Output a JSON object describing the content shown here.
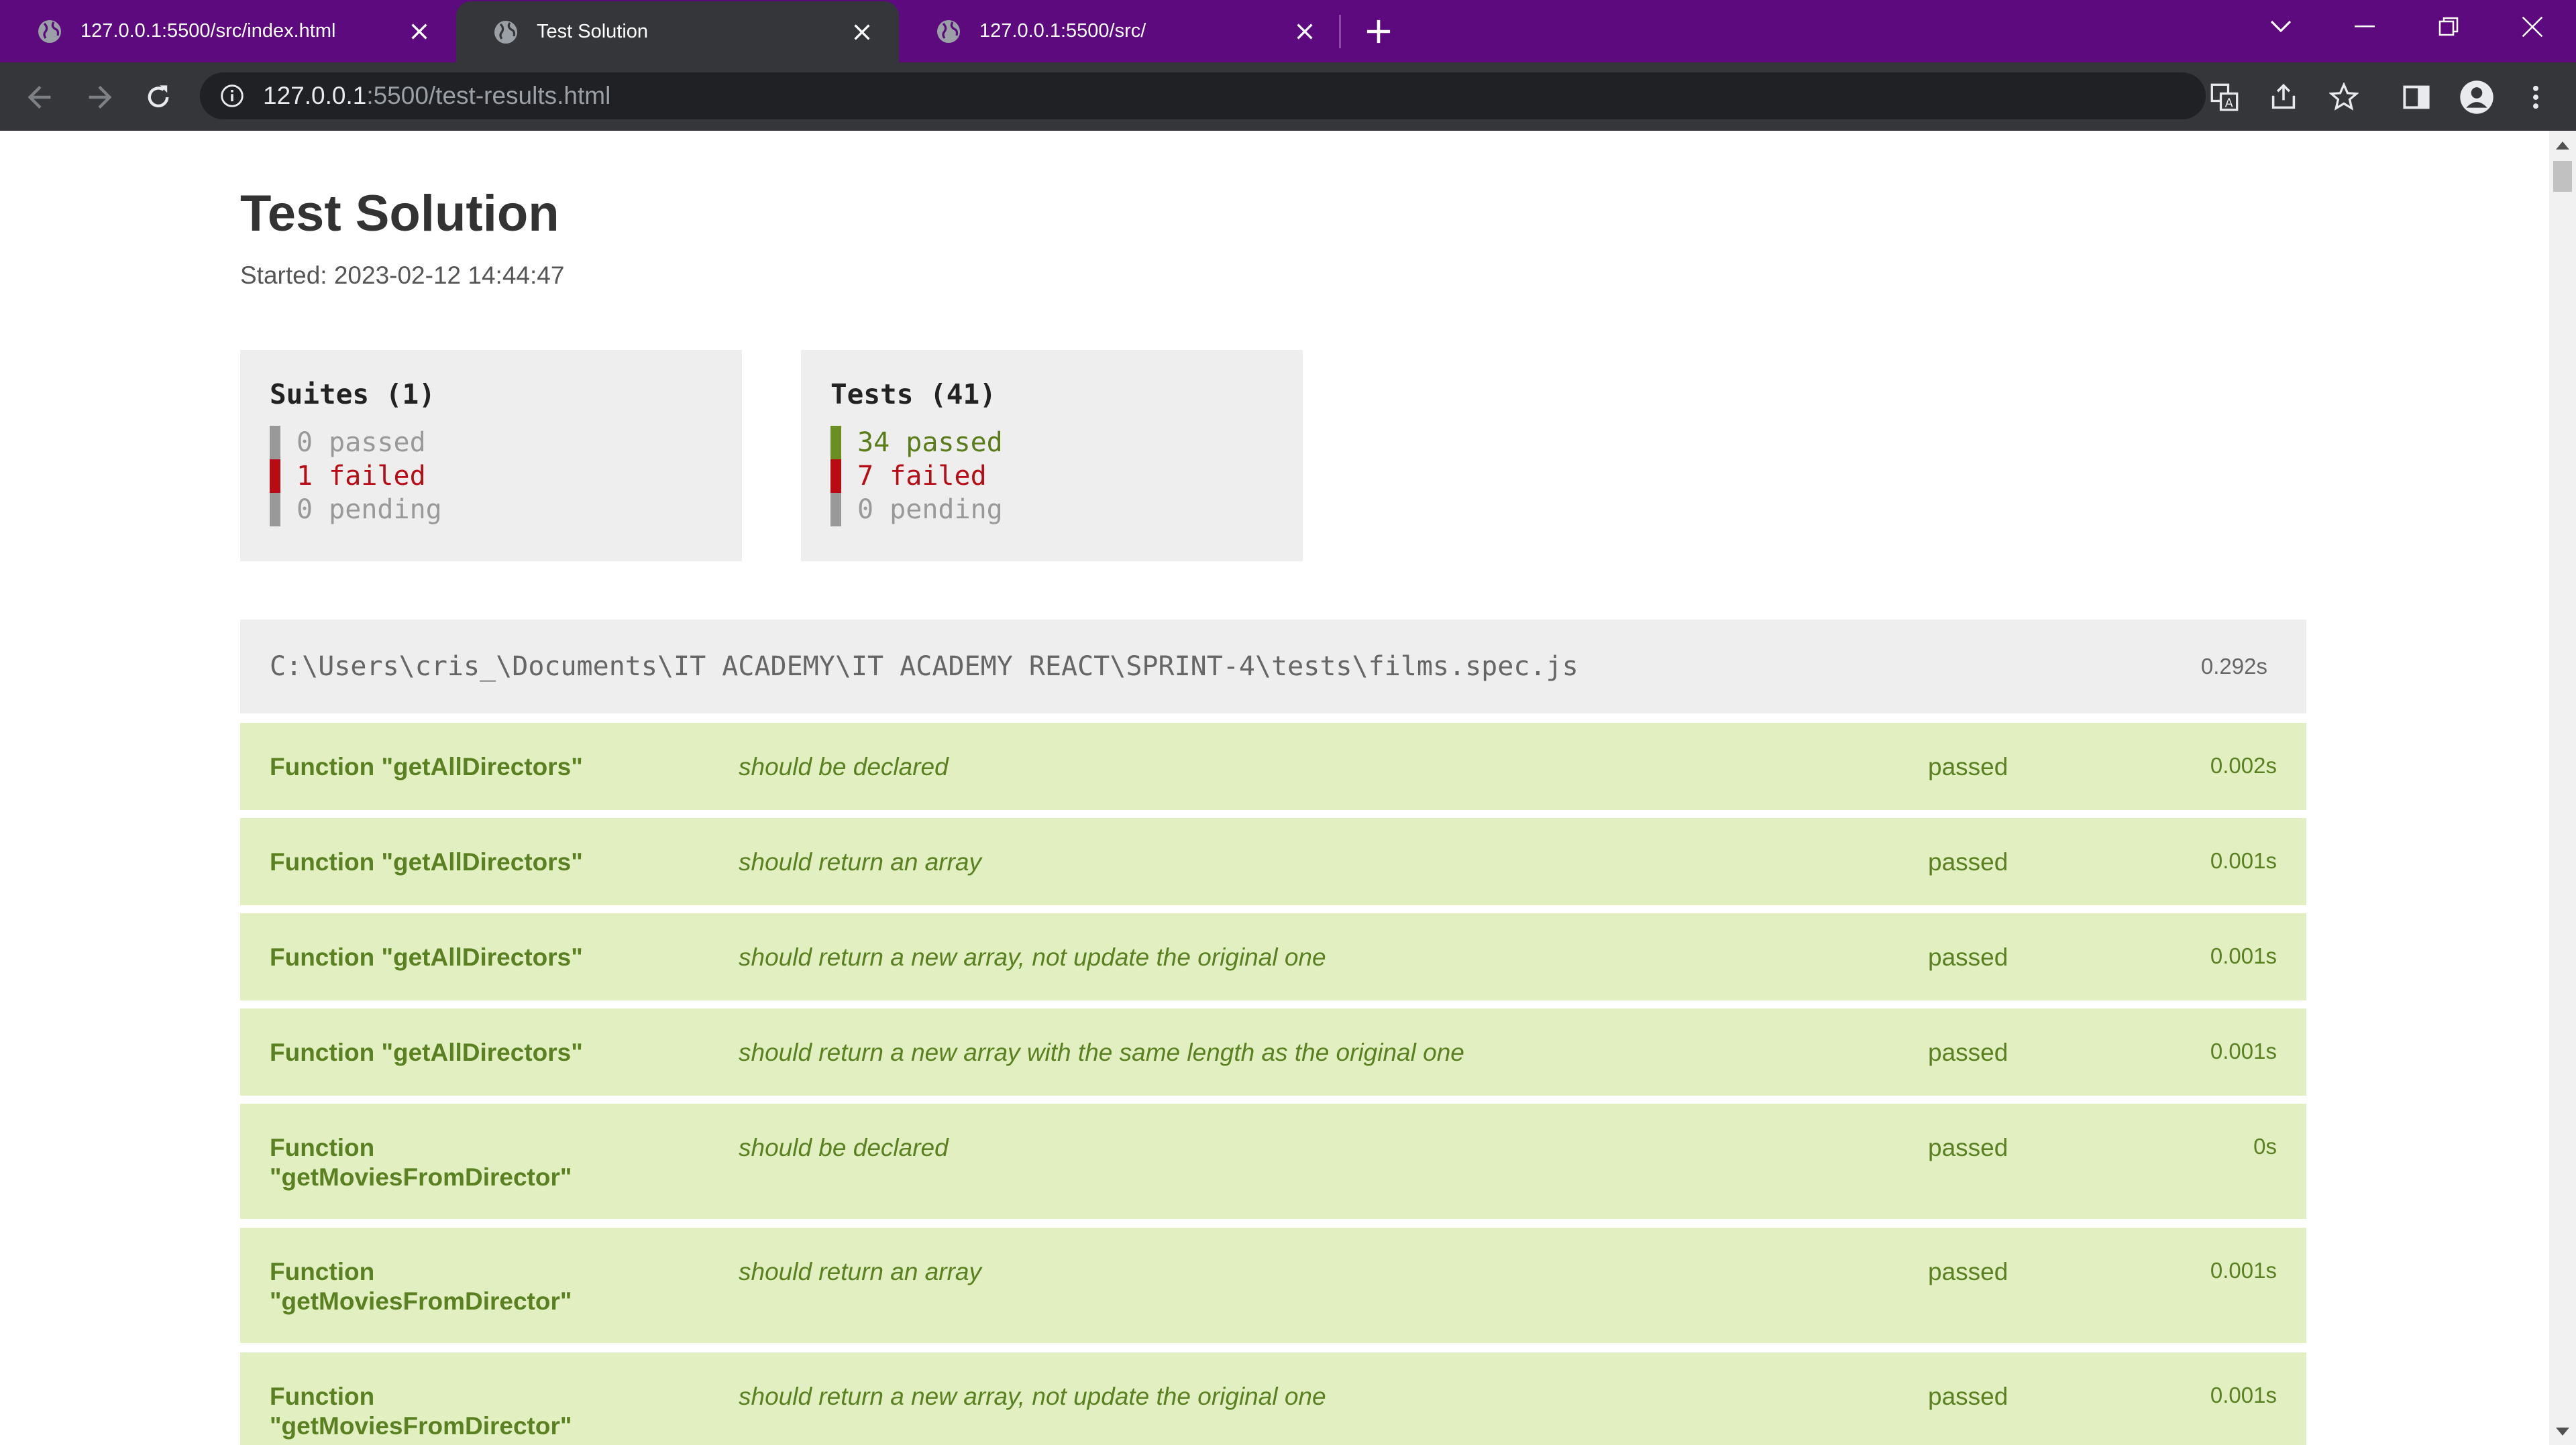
{
  "browser": {
    "tabs": [
      {
        "title": "127.0.0.1:5500/src/index.html",
        "active": false
      },
      {
        "title": "Test Solution",
        "active": true
      },
      {
        "title": "127.0.0.1:5500/src/",
        "active": false
      }
    ],
    "address": {
      "host": "127.0.0.1",
      "rest": ":5500/test-results.html"
    },
    "colors": {
      "tabbar": "#5c0a7e",
      "toolbar": "#35363a"
    }
  },
  "page": {
    "title": "Test Solution",
    "started": "Started: 2023-02-12 14:44:47"
  },
  "summary": {
    "suites": {
      "title": "Suites (1)",
      "passed": "0 passed",
      "failed": "1 failed",
      "pending": "0 pending"
    },
    "tests": {
      "title": "Tests (41)",
      "passed": "34 passed",
      "failed": "7 failed",
      "pending": "0 pending"
    }
  },
  "suite": {
    "path": "C:\\Users\\cris_\\Documents\\IT ACADEMY\\IT ACADEMY REACT\\SPRINT-4\\tests\\films.spec.js",
    "time": "0.292s"
  },
  "tests": [
    {
      "name": "Function \"getAllDirectors\"",
      "desc": "should be declared",
      "status": "passed",
      "time": "0.002s"
    },
    {
      "name": "Function \"getAllDirectors\"",
      "desc": "should return an array",
      "status": "passed",
      "time": "0.001s"
    },
    {
      "name": "Function \"getAllDirectors\"",
      "desc": "should return a new array, not update the original one",
      "status": "passed",
      "time": "0.001s"
    },
    {
      "name": "Function \"getAllDirectors\"",
      "desc": "should return a new array with the same length as the original one",
      "status": "passed",
      "time": "0.001s"
    },
    {
      "name": "Function \"getMoviesFromDirector\"",
      "desc": "should be declared",
      "status": "passed",
      "time": "0s"
    },
    {
      "name": "Function \"getMoviesFromDirector\"",
      "desc": "should return an array",
      "status": "passed",
      "time": "0.001s"
    },
    {
      "name": "Function \"getMoviesFromDirector\"",
      "desc": "should return a new array, not update the original one",
      "status": "passed",
      "time": "0.001s"
    }
  ],
  "colors": {
    "passed_row": "#e2efc0",
    "passed_text": "#5a8021",
    "failed": "#b80b13",
    "pending": "#999999"
  }
}
